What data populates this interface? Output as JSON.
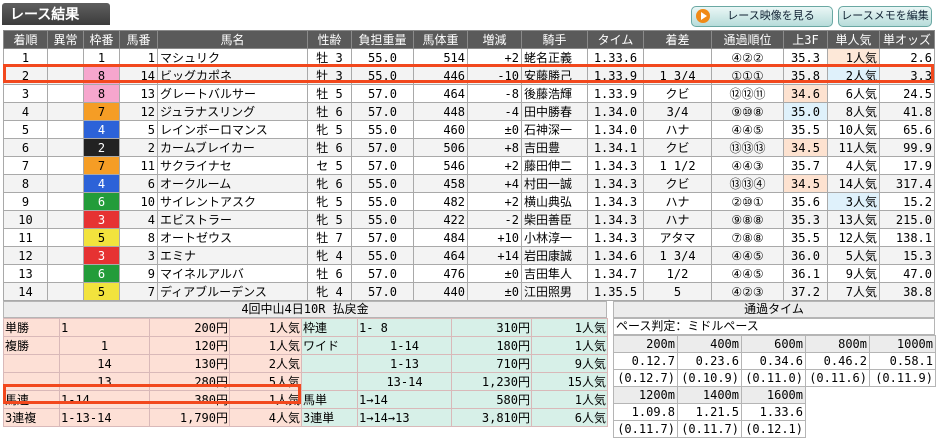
{
  "header": {
    "title": "レース結果",
    "video_button": "レース映像を見る",
    "memo_button": "レースメモを編集"
  },
  "results": {
    "columns": [
      "着順",
      "異常",
      "枠番",
      "馬番",
      "馬名",
      "性齢",
      "負担重量",
      "馬体重",
      "増減",
      "騎手",
      "タイム",
      "着差",
      "通過順位",
      "上3F",
      "単人気",
      "単オッズ"
    ],
    "rows": [
      {
        "pos": "1",
        "ab": "",
        "waku": "1",
        "uma": "1",
        "name": "マシュリク",
        "sexage": "牡 3",
        "kin": "55.0",
        "weight": "514",
        "diff": "+2",
        "jockey": "蛯名正義",
        "time": "1.33.6",
        "margin": "",
        "pass": "④②②",
        "f3": "35.3",
        "pop": "1人気",
        "odds": "2.6"
      },
      {
        "pos": "2",
        "ab": "",
        "waku": "8",
        "uma": "14",
        "name": "ビッグカポネ",
        "sexage": "牡 3",
        "kin": "55.0",
        "weight": "446",
        "diff": "-10",
        "jockey": "安藤勝己",
        "time": "1.33.9",
        "margin": "1 3/4",
        "pass": "①①①",
        "f3": "35.8",
        "pop": "2人気",
        "odds": "3.3"
      },
      {
        "pos": "3",
        "ab": "",
        "waku": "8",
        "uma": "13",
        "name": "グレートバルサー",
        "sexage": "牡 5",
        "kin": "57.0",
        "weight": "464",
        "diff": "-8",
        "jockey": "後藤浩輝",
        "time": "1.33.9",
        "margin": "クビ",
        "pass": "⑫⑫⑪",
        "f3": "34.6",
        "pop": "6人気",
        "odds": "24.5"
      },
      {
        "pos": "4",
        "ab": "",
        "waku": "7",
        "uma": "12",
        "name": "ジュラナスリング",
        "sexage": "牡 6",
        "kin": "57.0",
        "weight": "448",
        "diff": "-4",
        "jockey": "田中勝春",
        "time": "1.34.0",
        "margin": "3/4",
        "pass": "⑨⑩⑧",
        "f3": "35.0",
        "pop": "8人気",
        "odds": "41.8"
      },
      {
        "pos": "5",
        "ab": "",
        "waku": "4",
        "uma": "5",
        "name": "レインボーロマンス",
        "sexage": "牝 5",
        "kin": "55.0",
        "weight": "460",
        "diff": "±0",
        "jockey": "石神深一",
        "time": "1.34.0",
        "margin": "ハナ",
        "pass": "④④⑤",
        "f3": "35.5",
        "pop": "10人気",
        "odds": "65.6"
      },
      {
        "pos": "6",
        "ab": "",
        "waku": "2",
        "uma": "2",
        "name": "カームブレイカー",
        "sexage": "牡 6",
        "kin": "57.0",
        "weight": "506",
        "diff": "+8",
        "jockey": "吉田豊",
        "time": "1.34.1",
        "margin": "クビ",
        "pass": "⑬⑬⑬",
        "f3": "34.5",
        "pop": "11人気",
        "odds": "99.9"
      },
      {
        "pos": "7",
        "ab": "",
        "waku": "7",
        "uma": "11",
        "name": "サクライナセ",
        "sexage": "セ 5",
        "kin": "57.0",
        "weight": "546",
        "diff": "+2",
        "jockey": "藤田伸二",
        "time": "1.34.3",
        "margin": "1 1/2",
        "pass": "④④③",
        "f3": "35.7",
        "pop": "4人気",
        "odds": "17.9"
      },
      {
        "pos": "8",
        "ab": "",
        "waku": "4",
        "uma": "6",
        "name": "オークルーム",
        "sexage": "牝 6",
        "kin": "55.0",
        "weight": "458",
        "diff": "+4",
        "jockey": "村田一誠",
        "time": "1.34.3",
        "margin": "クビ",
        "pass": "⑬⑬④",
        "f3": "34.5",
        "pop": "14人気",
        "odds": "317.4"
      },
      {
        "pos": "9",
        "ab": "",
        "waku": "6",
        "uma": "10",
        "name": "サイレントアスク",
        "sexage": "牝 5",
        "kin": "55.0",
        "weight": "482",
        "diff": "+2",
        "jockey": "横山典弘",
        "time": "1.34.3",
        "margin": "ハナ",
        "pass": "②⑩①",
        "f3": "35.6",
        "pop": "3人気",
        "odds": "15.2"
      },
      {
        "pos": "10",
        "ab": "",
        "waku": "3",
        "uma": "4",
        "name": "エビストラー",
        "sexage": "牝 5",
        "kin": "55.0",
        "weight": "422",
        "diff": "-2",
        "jockey": "柴田善臣",
        "time": "1.34.3",
        "margin": "ハナ",
        "pass": "⑨⑧⑧",
        "f3": "35.3",
        "pop": "13人気",
        "odds": "215.0"
      },
      {
        "pos": "11",
        "ab": "",
        "waku": "5",
        "uma": "8",
        "name": "オートゼウス",
        "sexage": "牡 7",
        "kin": "57.0",
        "weight": "484",
        "diff": "+10",
        "jockey": "小林淳一",
        "time": "1.34.3",
        "margin": "アタマ",
        "pass": "⑦⑧⑧",
        "f3": "35.5",
        "pop": "12人気",
        "odds": "138.1"
      },
      {
        "pos": "12",
        "ab": "",
        "waku": "3",
        "uma": "3",
        "name": "エミナ",
        "sexage": "牝 4",
        "kin": "55.0",
        "weight": "464",
        "diff": "+14",
        "jockey": "岩田康誠",
        "time": "1.34.6",
        "margin": "1 3/4",
        "pass": "④④⑤",
        "f3": "36.0",
        "pop": "5人気",
        "odds": "15.3"
      },
      {
        "pos": "13",
        "ab": "",
        "waku": "6",
        "uma": "9",
        "name": "マイネルアルバ",
        "sexage": "牡 6",
        "kin": "57.0",
        "weight": "476",
        "diff": "±0",
        "jockey": "吉田隼人",
        "time": "1.34.7",
        "margin": "1/2",
        "pass": "④④⑤",
        "f3": "36.1",
        "pop": "9人気",
        "odds": "47.0"
      },
      {
        "pos": "14",
        "ab": "",
        "waku": "5",
        "uma": "7",
        "name": "ディアブルーデンス",
        "sexage": "牝 4",
        "kin": "57.0",
        "weight": "440",
        "diff": "±0",
        "jockey": "江田照男",
        "time": "1.35.5",
        "margin": "5",
        "pass": "④②③",
        "f3": "37.2",
        "pop": "7人気",
        "odds": "38.8"
      }
    ]
  },
  "payout": {
    "title": "4回中山4日10R 払戻金",
    "rows": [
      {
        "lt": "単勝",
        "lc": "1",
        "la": "200円",
        "lp": "1人気",
        "rt": "枠連",
        "rc": "1- 8",
        "ra": "310円",
        "rp": "1人気"
      },
      {
        "lt": "複勝",
        "lc": "1",
        "la": "120円",
        "lp": "1人気",
        "rt": "ワイド",
        "rc": "1-14",
        "ra": "180円",
        "rp": "1人気"
      },
      {
        "lt": "",
        "lc": "14",
        "la": "130円",
        "lp": "2人気",
        "rt": "",
        "rc": "1-13",
        "ra": "710円",
        "rp": "9人気"
      },
      {
        "lt": "",
        "lc": "13",
        "la": "280円",
        "lp": "5人気",
        "rt": "",
        "rc": "13-14",
        "ra": "1,230円",
        "rp": "15人気"
      },
      {
        "lt": "馬連",
        "lc": "1-14",
        "la": "380円",
        "lp": "1人気",
        "rt": "馬単",
        "rc": "1→14",
        "ra": "580円",
        "rp": "1人気"
      },
      {
        "lt": "3連複",
        "lc": "1-13-14",
        "la": "1,790円",
        "lp": "4人気",
        "rt": "3連単",
        "rc": "1→14→13",
        "ra": "3,810円",
        "rp": "6人気"
      }
    ]
  },
  "timing": {
    "title": "通過タイム",
    "pace": "ペース判定：ミドルペース",
    "row1": [
      {
        "d": "200m",
        "t": "0.12.7",
        "s": "(0.12.7)"
      },
      {
        "d": "400m",
        "t": "0.23.6",
        "s": "(0.10.9)"
      },
      {
        "d": "600m",
        "t": "0.34.6",
        "s": "(0.11.0)"
      },
      {
        "d": "800m",
        "t": "0.46.2",
        "s": "(0.11.6)"
      },
      {
        "d": "1000m",
        "t": "0.58.1",
        "s": "(0.11.9)"
      }
    ],
    "row2": [
      {
        "d": "1200m",
        "t": "1.09.8",
        "s": "(0.11.7)"
      },
      {
        "d": "1400m",
        "t": "1.21.5",
        "s": "(0.11.7)"
      },
      {
        "d": "1600m",
        "t": "1.33.6",
        "s": "(0.12.1)"
      }
    ]
  },
  "colors": {
    "accent": "#f2481d",
    "header_bg": "#5a5a5a",
    "waku_pink": "#f6a6cd",
    "hl_orange": "#fde2d0",
    "hl_blue": "#dff1fb"
  }
}
